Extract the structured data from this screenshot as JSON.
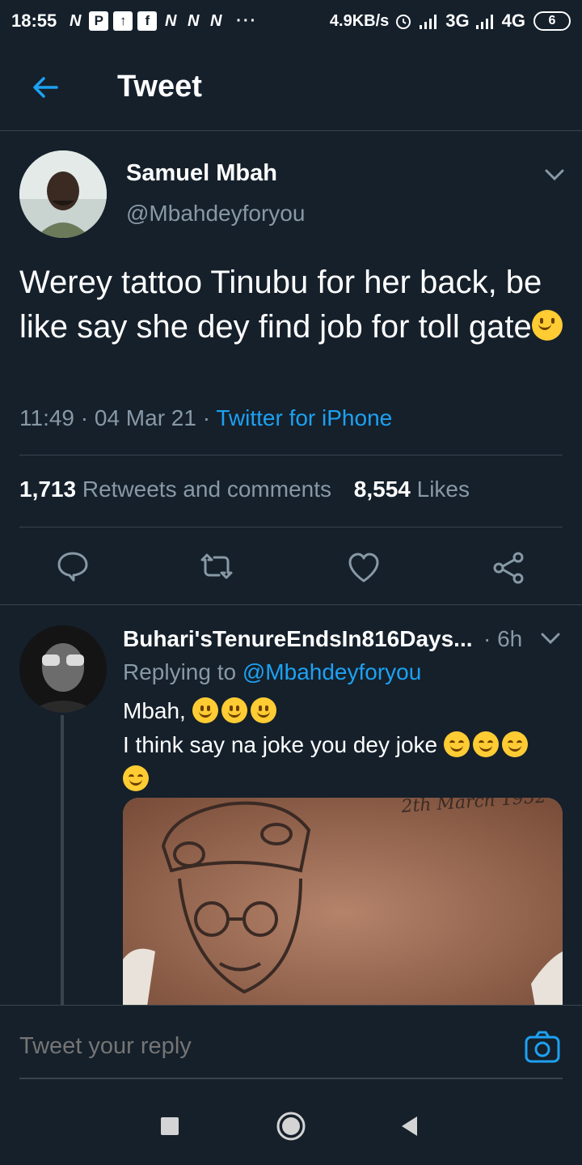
{
  "status_bar": {
    "time": "18:55",
    "notif_icons": [
      "N",
      "P",
      "↑",
      "f",
      "N",
      "N",
      "N"
    ],
    "dots": "···",
    "speed": "4.9KB/s",
    "network_3g": "3G",
    "network_4g": "4G",
    "battery": "6"
  },
  "header": {
    "title": "Tweet"
  },
  "tweet": {
    "author_name": "Samuel Mbah",
    "author_handle": "@Mbahdeyforyou",
    "text": "Werey tattoo Tinubu for her back, be like say she dey find job for toll gate",
    "time": "11:49 · 04 Mar 21",
    "separator": "·",
    "source": "Twitter for iPhone",
    "retweets_count": "1,713",
    "retweets_label": "Retweets and comments",
    "likes_count": "8,554",
    "likes_label": "Likes"
  },
  "actions": {
    "reply_icon": "comment-icon",
    "retweet_icon": "retweet-icon",
    "like_icon": "heart-icon",
    "share_icon": "share-icon"
  },
  "reply": {
    "name": "Buhari'sTenureEndsIn816Days...",
    "time": "· 6h",
    "replying_prefix": "Replying to",
    "replying_to": "@Mbahdeyforyou",
    "line1": "Mbah,",
    "line2": "I think say na joke you dey joke",
    "image_caption": "2th March 1952"
  },
  "reply_bar": {
    "placeholder": "Tweet your reply"
  },
  "colors": {
    "background": "#15202b",
    "accent": "#1da1f2",
    "secondary_text": "#8899a6",
    "divider": "#38444d"
  }
}
